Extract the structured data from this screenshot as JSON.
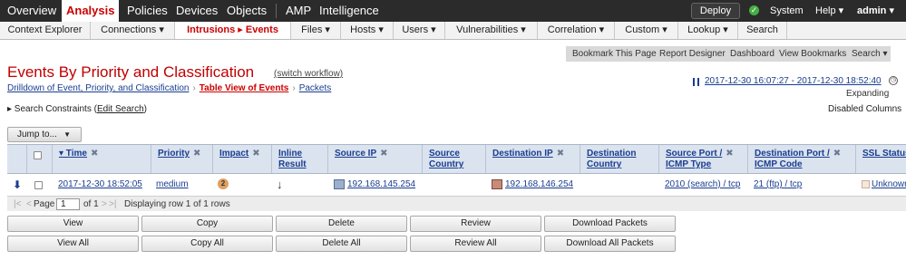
{
  "top_nav": {
    "items": [
      "Overview",
      "Analysis",
      "Policies",
      "Devices",
      "Objects",
      "AMP",
      "Intelligence"
    ],
    "active": "Analysis",
    "deploy_label": "Deploy",
    "system_label": "System",
    "help_label": "Help ▾",
    "user_label": "admin ▾"
  },
  "sub_nav": {
    "items": [
      "Context Explorer",
      "Connections ▾",
      "Intrusions ▸ Events",
      "Files ▾",
      "Hosts ▾",
      "Users ▾",
      "Vulnerabilities ▾",
      "Correlation ▾",
      "Custom ▾",
      "Lookup ▾",
      "Search"
    ]
  },
  "bookmark_bar": {
    "items": [
      "Bookmark This Page",
      "Report Designer",
      "Dashboard",
      "View Bookmarks",
      "Search ▾"
    ]
  },
  "page": {
    "title": "Events By Priority and Classification",
    "switch_workflow": "(switch workflow)",
    "breadcrumbs": [
      "Drilldown of Event, Priority, and Classification",
      "Table View of Events",
      "Packets"
    ],
    "time_range": "2017-12-30 16:07:27 - 2017-12-30 18:52:40",
    "expanding": "Expanding",
    "search_constraints_prefix": "▸ Search Constraints (",
    "edit_search": "Edit Search",
    "search_constraints_suffix": ")",
    "disabled_columns": "Disabled Columns",
    "jump_to": "Jump to...",
    "jump_arrow": "▼"
  },
  "table": {
    "columns": {
      "time": "▾ Time",
      "priority": "Priority",
      "impact": "Impact",
      "inline_result_1": "Inline",
      "inline_result_2": "Result",
      "source_ip": "Source IP",
      "source_country_1": "Source",
      "source_country_2": "Country",
      "destination_ip": "Destination IP",
      "destination_country_1": "Destination",
      "destination_country_2": "Country",
      "source_port_1": "Source Port /",
      "source_port_2": "ICMP Type",
      "destination_port_1": "Destination Port /",
      "destination_port_2": "ICMP Code",
      "ssl_status": "SSL Status"
    },
    "remove_mark": "✖",
    "row": {
      "time": "2017-12-30 18:52:05",
      "priority": "medium",
      "impact": "2",
      "inline_result": "↓",
      "source_ip": "192.168.145.254",
      "destination_ip": "192.168.146.254",
      "source_port": "2010 (search) / tcp",
      "destination_port": "21 (ftp) / tcp",
      "ssl_status": "Unknown"
    }
  },
  "pager": {
    "first": "|<",
    "prev": "<",
    "page_label": "Page",
    "page_value": "1",
    "of_label": "of 1",
    "next": ">",
    "last": ">|",
    "status": "Displaying row 1 of 1 rows"
  },
  "actions": {
    "row1": [
      "View",
      "Copy",
      "Delete",
      "Review",
      "Download Packets"
    ],
    "row2": [
      "View All",
      "Copy All",
      "Delete All",
      "Review All",
      "Download All Packets"
    ]
  }
}
